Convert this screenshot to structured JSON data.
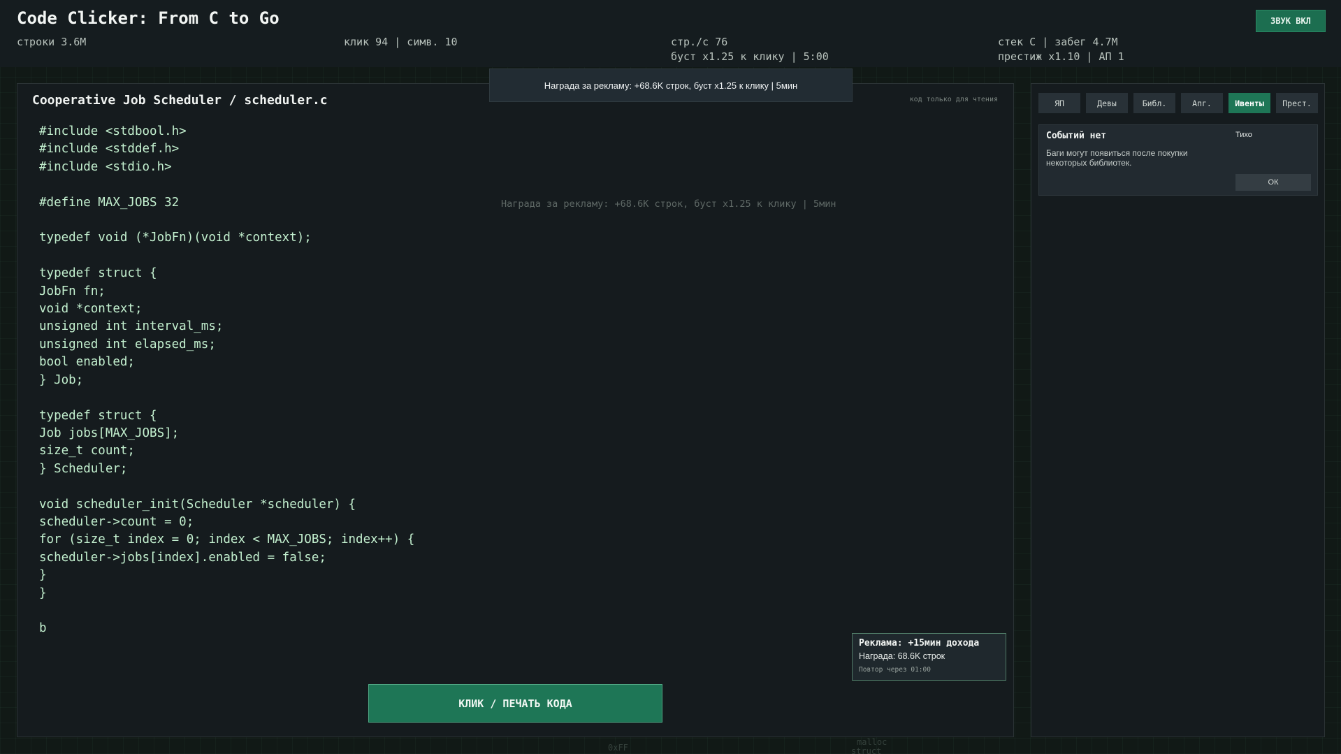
{
  "header": {
    "title": "Code Clicker: From C to Go",
    "lines": "строки 3.6M",
    "click_chars": "клик 94 | симв. 10",
    "lines_per_sec": "стр./с 76",
    "boost": "буст x1.25 к клику | 5:00",
    "stack_run": "стек C | забег 4.7M",
    "prestige": "престиж x1.10 | АП 1",
    "sound_button": "ЗВУК ВКЛ"
  },
  "toast": {
    "text": "Награда за рекламу: +68.6K строк, буст x1.25 к клику | 5мин"
  },
  "editor": {
    "file_title": "Cooperative Job Scheduler / scheduler.c",
    "readonly_label": "код только для чтения",
    "code": "#include <stdbool.h>\n#include <stddef.h>\n#include <stdio.h>\n\n#define MAX_JOBS 32\n\ntypedef void (*JobFn)(void *context);\n\ntypedef struct {\nJobFn fn;\nvoid *context;\nunsigned int interval_ms;\nunsigned int elapsed_ms;\nbool enabled;\n} Job;\n\ntypedef struct {\nJob jobs[MAX_JOBS];\nsize_t count;\n} Scheduler;\n\nvoid scheduler_init(Scheduler *scheduler) {\nscheduler->count = 0;\nfor (size_t index = 0; index < MAX_JOBS; index++) {\nscheduler->jobs[index].enabled = false;\n}\n}\n\nb",
    "ghost_text": "Награда за рекламу: +68.6K строк, буст x1.25 к клику | 5мин",
    "click_button": "КЛИК / ПЕЧАТЬ КОДА"
  },
  "ad_card": {
    "title": "Реклама: +15мин дохода",
    "reward": "Награда: 68.6K строк",
    "repeat": "Повтор через 01:00"
  },
  "sidebar": {
    "tabs": [
      {
        "label": "ЯП",
        "active": false
      },
      {
        "label": "Девы",
        "active": false
      },
      {
        "label": "Библ.",
        "active": false
      },
      {
        "label": "Апг.",
        "active": false
      },
      {
        "label": "Ивенты",
        "active": true
      },
      {
        "label": "Прест.",
        "active": false
      }
    ],
    "events": {
      "title": "Событий нет",
      "status": "Тихо",
      "description": "Баги могут появиться после покупки некоторых библиотек.",
      "ok_button": "ОК"
    }
  },
  "background": {
    "deco_1": "0xFF",
    "deco_2": "malloc",
    "deco_3": "struct"
  },
  "colors": {
    "accent": "#1e7656",
    "code_text": "#c3f0cf",
    "background": "#111916"
  }
}
